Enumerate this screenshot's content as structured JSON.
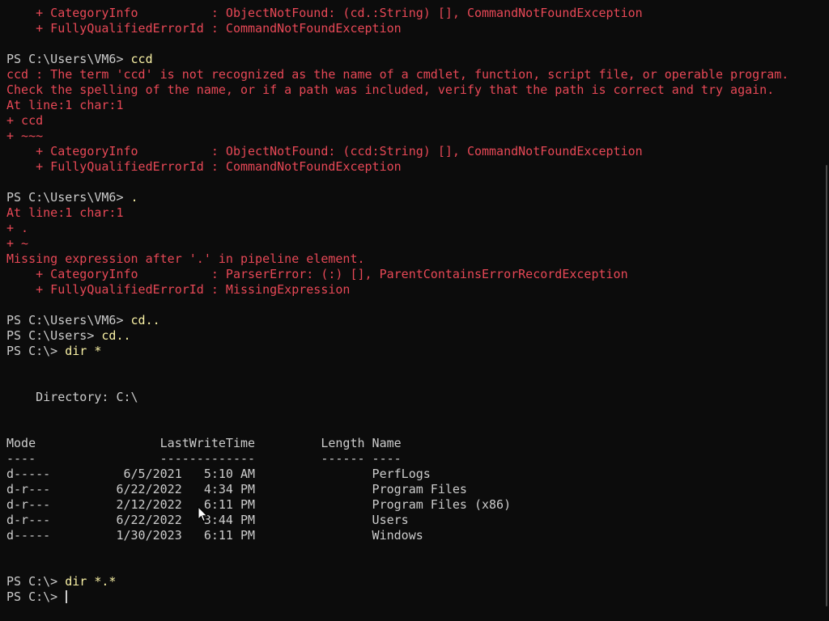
{
  "colors": {
    "background": "#0c0c0c",
    "foreground": "#cccccc",
    "error": "#e74856",
    "command": "#f9f1a5"
  },
  "lines": [
    {
      "t": "err",
      "text": "    + CategoryInfo          : ObjectNotFound: (cd.:String) [], CommandNotFoundException"
    },
    {
      "t": "err",
      "text": "    + FullyQualifiedErrorId : CommandNotFoundException"
    },
    {
      "t": "blank",
      "text": ""
    },
    {
      "t": "prompt",
      "prompt": "PS C:\\Users\\VM6> ",
      "cmd": "ccd"
    },
    {
      "t": "err",
      "text": "ccd : The term 'ccd' is not recognized as the name of a cmdlet, function, script file, or operable program."
    },
    {
      "t": "err",
      "text": "Check the spelling of the name, or if a path was included, verify that the path is correct and try again."
    },
    {
      "t": "err",
      "text": "At line:1 char:1"
    },
    {
      "t": "err",
      "text": "+ ccd"
    },
    {
      "t": "err",
      "text": "+ ~~~"
    },
    {
      "t": "err",
      "text": "    + CategoryInfo          : ObjectNotFound: (ccd:String) [], CommandNotFoundException"
    },
    {
      "t": "err",
      "text": "    + FullyQualifiedErrorId : CommandNotFoundException"
    },
    {
      "t": "blank",
      "text": ""
    },
    {
      "t": "prompt",
      "prompt": "PS C:\\Users\\VM6> ",
      "cmd": "."
    },
    {
      "t": "err",
      "text": "At line:1 char:1"
    },
    {
      "t": "err",
      "text": "+ ."
    },
    {
      "t": "err",
      "text": "+ ~"
    },
    {
      "t": "err",
      "text": "Missing expression after '.' in pipeline element."
    },
    {
      "t": "err",
      "text": "    + CategoryInfo          : ParserError: (:) [], ParentContainsErrorRecordException"
    },
    {
      "t": "err",
      "text": "    + FullyQualifiedErrorId : MissingExpression"
    },
    {
      "t": "blank",
      "text": ""
    },
    {
      "t": "prompt",
      "prompt": "PS C:\\Users\\VM6> ",
      "cmd": "cd.."
    },
    {
      "t": "prompt",
      "prompt": "PS C:\\Users> ",
      "cmd": "cd.."
    },
    {
      "t": "prompt",
      "prompt": "PS C:\\> ",
      "cmd": "dir *"
    },
    {
      "t": "blank",
      "text": ""
    },
    {
      "t": "blank",
      "text": ""
    },
    {
      "t": "normal",
      "text": "    Directory: C:\\"
    },
    {
      "t": "blank",
      "text": ""
    },
    {
      "t": "blank",
      "text": ""
    },
    {
      "t": "normal",
      "text": "Mode                 LastWriteTime         Length Name"
    },
    {
      "t": "normal",
      "text": "----                 -------------         ------ ----"
    },
    {
      "t": "normal",
      "text": "d-----          6/5/2021   5:10 AM                PerfLogs"
    },
    {
      "t": "normal",
      "text": "d-r---         6/22/2022   4:34 PM                Program Files"
    },
    {
      "t": "normal",
      "text": "d-r---         2/12/2022   6:11 PM                Program Files (x86)"
    },
    {
      "t": "normal",
      "text": "d-r---         6/22/2022   3:44 PM                Users"
    },
    {
      "t": "normal",
      "text": "d-----         1/30/2023   6:11 PM                Windows"
    },
    {
      "t": "blank",
      "text": ""
    },
    {
      "t": "blank",
      "text": ""
    },
    {
      "t": "prompt",
      "prompt": "PS C:\\> ",
      "cmd": "dir *.*"
    },
    {
      "t": "prompt-cursor",
      "prompt": "PS C:\\> ",
      "cmd": ""
    }
  ]
}
